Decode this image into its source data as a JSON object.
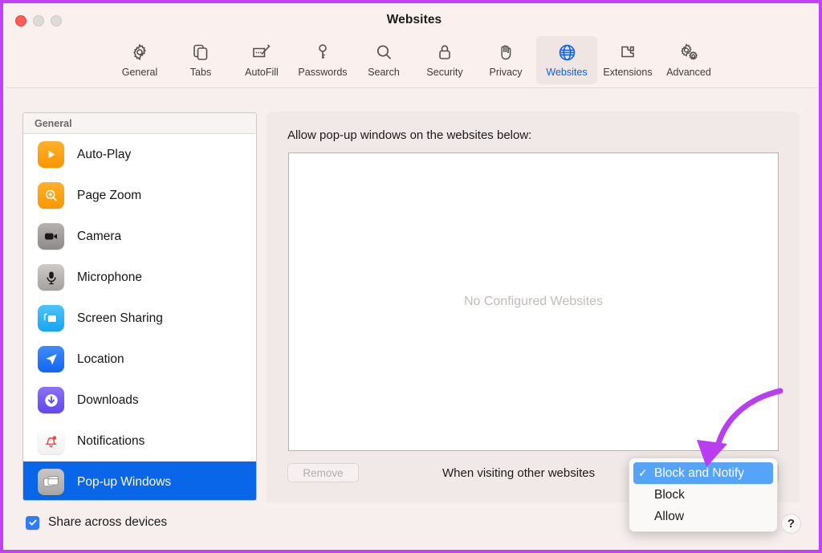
{
  "window": {
    "title": "Websites",
    "traffic_lights": [
      "close-button",
      "minimize-button",
      "maximize-button"
    ]
  },
  "toolbar": {
    "items": [
      {
        "label": "General",
        "icon": "gear-icon",
        "selected": false
      },
      {
        "label": "Tabs",
        "icon": "tabs-icon",
        "selected": false
      },
      {
        "label": "AutoFill",
        "icon": "autofill-icon",
        "selected": false
      },
      {
        "label": "Passwords",
        "icon": "key-icon",
        "selected": false
      },
      {
        "label": "Search",
        "icon": "search-icon",
        "selected": false
      },
      {
        "label": "Security",
        "icon": "lock-icon",
        "selected": false
      },
      {
        "label": "Privacy",
        "icon": "hand-icon",
        "selected": false
      },
      {
        "label": "Websites",
        "icon": "globe-icon",
        "selected": true
      },
      {
        "label": "Extensions",
        "icon": "puzzle-icon",
        "selected": false
      },
      {
        "label": "Advanced",
        "icon": "gears-icon",
        "selected": false
      }
    ]
  },
  "sidebar": {
    "header": "General",
    "items": [
      {
        "label": "Auto-Play",
        "icon": "play-icon",
        "selected": false
      },
      {
        "label": "Page Zoom",
        "icon": "magnifier-plus-icon",
        "selected": false
      },
      {
        "label": "Camera",
        "icon": "camera-icon",
        "selected": false
      },
      {
        "label": "Microphone",
        "icon": "microphone-icon",
        "selected": false
      },
      {
        "label": "Screen Sharing",
        "icon": "screen-share-icon",
        "selected": false
      },
      {
        "label": "Location",
        "icon": "location-arrow-icon",
        "selected": false
      },
      {
        "label": "Downloads",
        "icon": "download-icon",
        "selected": false
      },
      {
        "label": "Notifications",
        "icon": "bell-icon",
        "selected": false
      },
      {
        "label": "Pop-up Windows",
        "icon": "windows-icon",
        "selected": true
      }
    ]
  },
  "share": {
    "label": "Share across devices",
    "checked": true
  },
  "main": {
    "title": "Allow pop-up windows on the websites below:",
    "empty_text": "No Configured Websites",
    "remove_label": "Remove",
    "visiting_label": "When visiting other websites",
    "popup_selected_value": "Block and Notify"
  },
  "menu": {
    "items": [
      {
        "label": "Block and Notify",
        "checked": true
      },
      {
        "label": "Block",
        "checked": false
      },
      {
        "label": "Allow",
        "checked": false
      }
    ],
    "checkmark": "✓"
  },
  "help": {
    "label": "?"
  },
  "colors": {
    "accent_blue": "#0a66e8",
    "menu_highlight": "#56a4f9",
    "annotation_purple": "#b83ef0",
    "window_border": "#c341f5",
    "toolbar_bg": "#faf1ef",
    "content_bg": "#f1e9e7"
  }
}
